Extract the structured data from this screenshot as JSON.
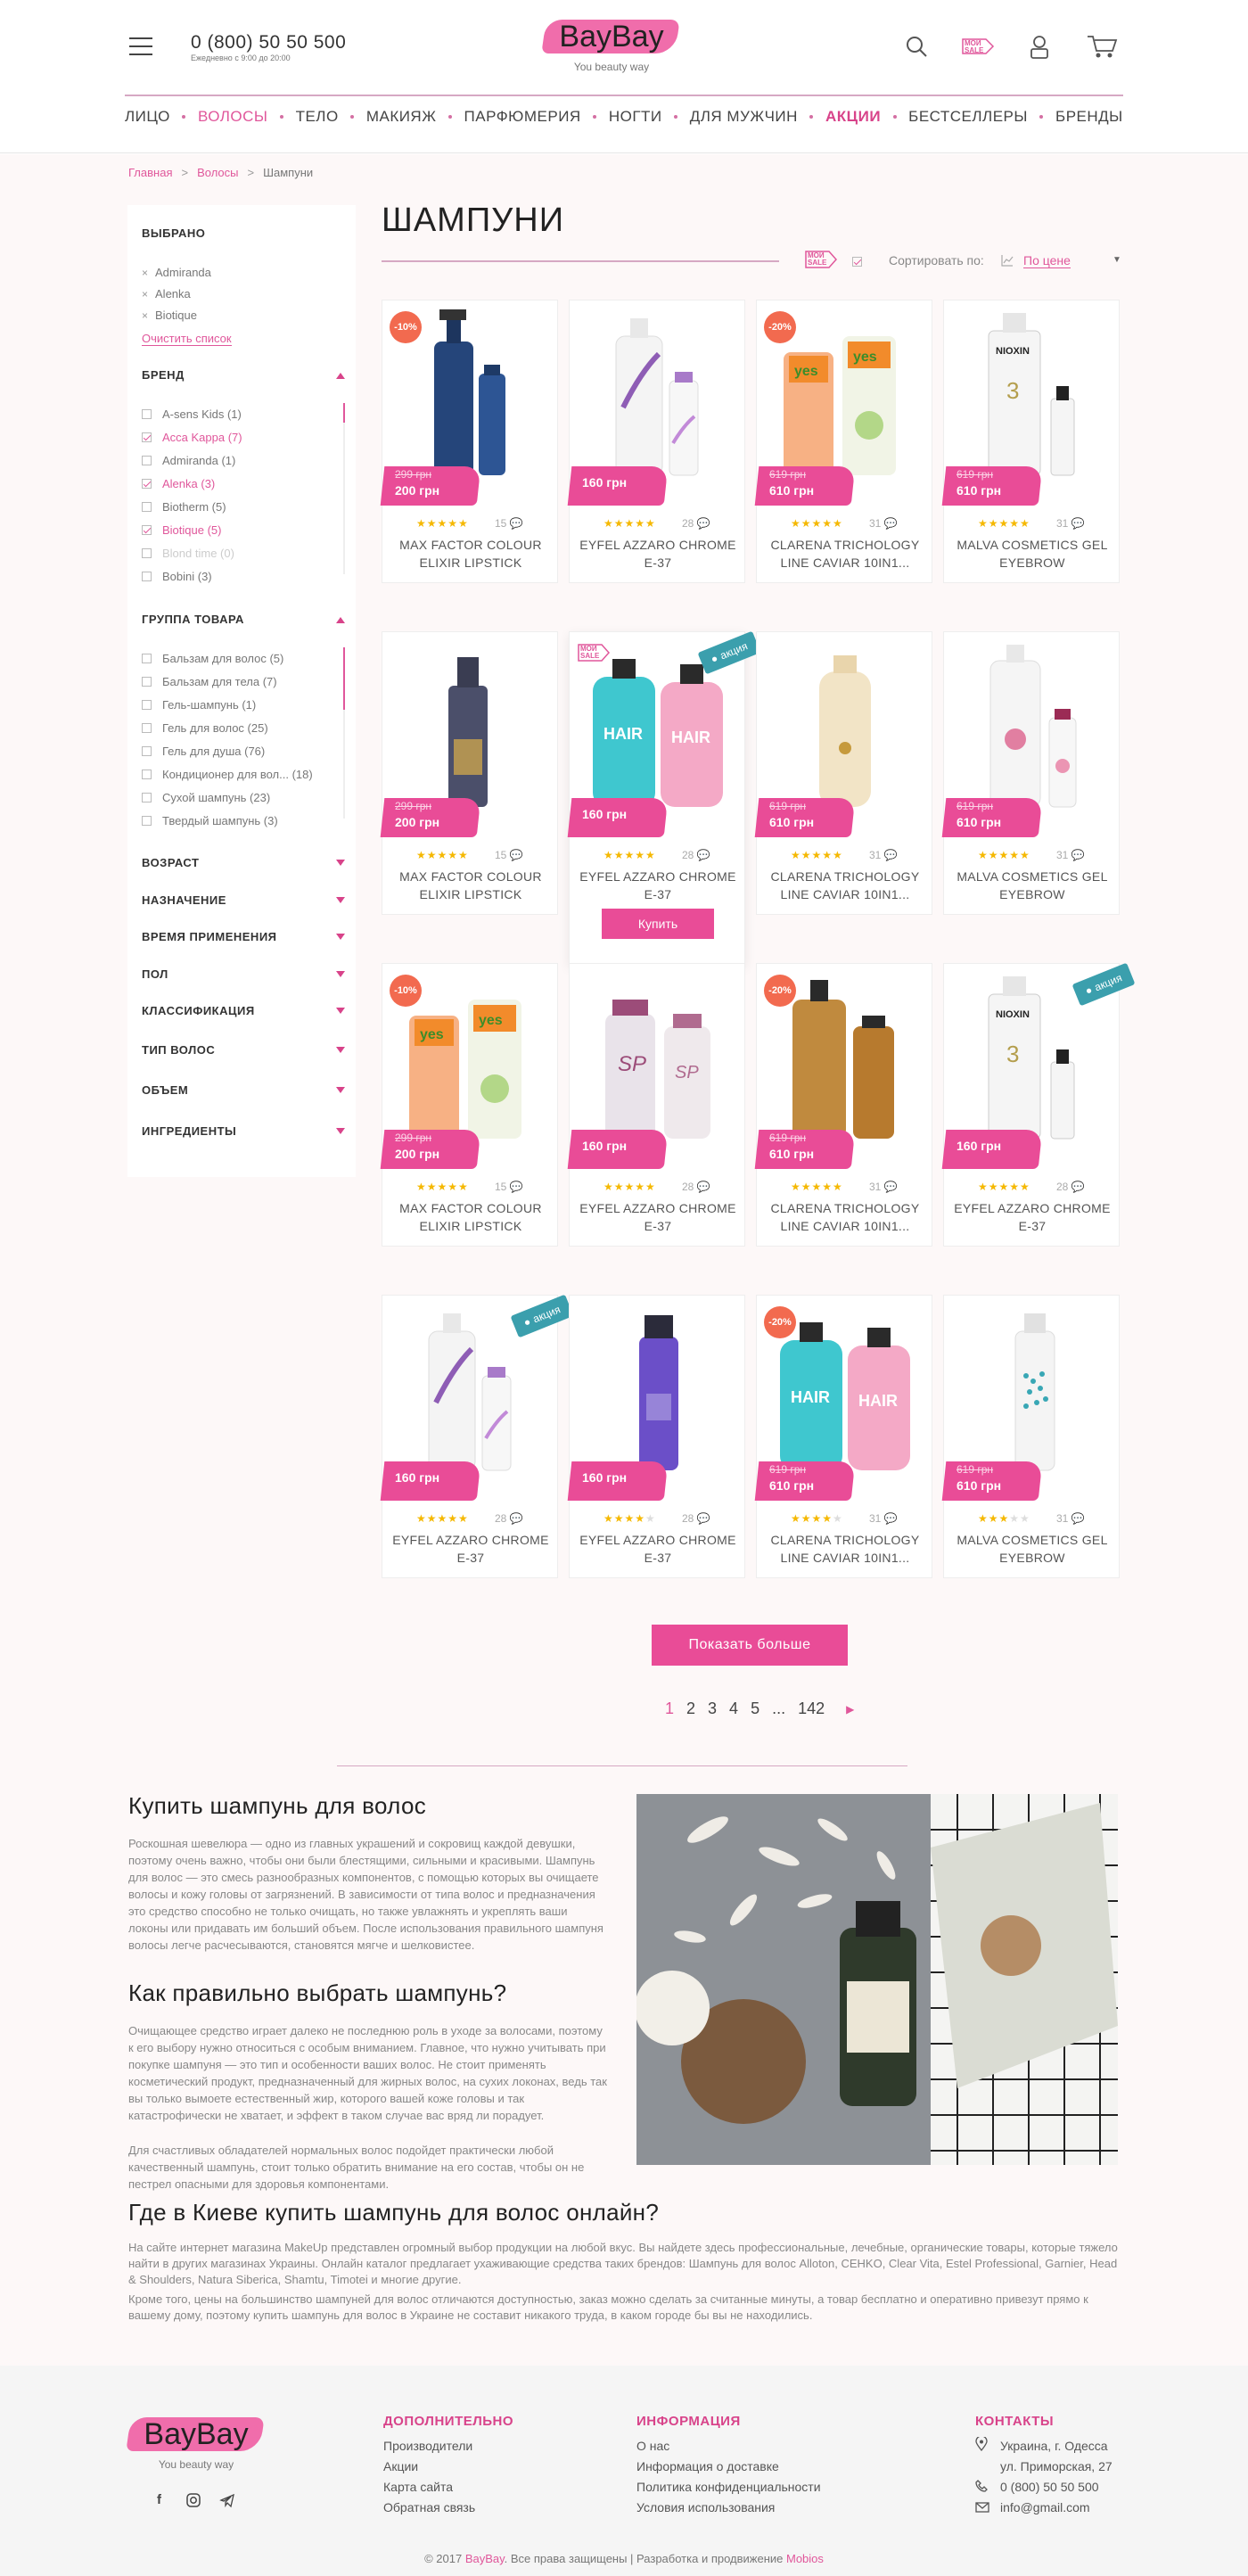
{
  "header": {
    "phone": "0 (800) 50 50 500",
    "phone_hours": "Ежедневно с 9:00 до 20:00",
    "logo": "BayBay",
    "slogan": "You beauty way",
    "my_sale": "МОЙ SALE"
  },
  "nav": [
    "ЛИЦО",
    "ВОЛОСЫ",
    "ТЕЛО",
    "МАКИЯЖ",
    "ПАРФЮМЕРИЯ",
    "НОГТИ",
    "ДЛЯ МУЖЧИН",
    "АКЦИИ",
    "БЕСТСЕЛЛЕРЫ",
    "БРЕНДЫ"
  ],
  "breadcrumbs": [
    "Главная",
    "Волосы",
    "Шампуни"
  ],
  "sidebar": {
    "selected_title": "ВЫБРАНО",
    "selected": [
      "Admiranda",
      "Alenka",
      "Biotique"
    ],
    "clear": "Очистить список",
    "brand_title": "БРЕНД",
    "brands": [
      {
        "label": "A-sens Kids (1)",
        "checked": false,
        "style": ""
      },
      {
        "label": "Acca Kappa (7)",
        "checked": true,
        "style": "pink"
      },
      {
        "label": "Admiranda (1)",
        "checked": false,
        "style": ""
      },
      {
        "label": "Alenka (3)",
        "checked": true,
        "style": "pink"
      },
      {
        "label": "Biotherm (5)",
        "checked": false,
        "style": ""
      },
      {
        "label": "Biotique (5)",
        "checked": true,
        "style": "pink"
      },
      {
        "label": "Blond time (0)",
        "checked": false,
        "style": "dim"
      },
      {
        "label": "Bobini (3)",
        "checked": false,
        "style": ""
      }
    ],
    "group_title": "ГРУППА ТОВАРА",
    "groups": [
      "Бальзам для волос (5)",
      "Бальзам для тела (7)",
      "Гель-шампунь (1)",
      "Гель для волос (25)",
      "Гель для душа (76)",
      "Кондиционер для вол... (18)",
      "Сухой шампунь (23)",
      "Твердый шампунь (3)"
    ],
    "collapsed": [
      "ВОЗРАСТ",
      "НАЗНАЧЕНИЕ",
      "ВРЕМЯ ПРИМЕНЕНИЯ",
      "ПОЛ",
      "КЛАССИФИКАЦИЯ",
      "ТИП ВОЛОС",
      "ОБЪЕМ",
      "ИНГРЕДИЕНТЫ"
    ]
  },
  "page": {
    "title": "ШАМПУНИ",
    "sort_label": "Сортировать по:",
    "sort_value": "По цене",
    "buy": "Купить",
    "sale_tag": "акция",
    "show_more": "Показать больше",
    "pages": [
      "1",
      "2",
      "3",
      "4",
      "5",
      "...",
      "142"
    ]
  },
  "products": [
    {
      "name": "MAX FACTOR COLOUR ELIXIR LIPSTICK",
      "old": "299 грн",
      "price": "200 грн",
      "discount": "-10%",
      "rating": 5,
      "reviews": "15",
      "img": "blue"
    },
    {
      "name": "EYFEL AZZARO CHROME E-37",
      "old": "",
      "price": "160 грн",
      "discount": "",
      "rating": 5,
      "reviews": "28",
      "img": "purple"
    },
    {
      "name": "CLARENA TRICHOLOGY LINE CAVIAR 10IN1...",
      "old": "619 грн",
      "price": "610 грн",
      "discount": "-20%",
      "rating": 5,
      "reviews": "31",
      "img": "orange"
    },
    {
      "name": "MALVA COSMETICS GEL EYEBROW",
      "old": "619 грн",
      "price": "610 грн",
      "discount": "",
      "rating": 5,
      "reviews": "31",
      "img": "nioxin"
    },
    {
      "name": "MAX FACTOR COLOUR ELIXIR LIPSTICK",
      "old": "299 грн",
      "price": "200 грн",
      "discount": "",
      "rating": 5,
      "reviews": "15",
      "img": "dark"
    },
    {
      "name": "EYFEL AZZARO CHROME E-37",
      "old": "",
      "price": "160 грн",
      "discount": "",
      "rating": 5,
      "reviews": "28",
      "img": "hair",
      "tag": true,
      "msale": true,
      "buy": true
    },
    {
      "name": "CLARENA TRICHOLOGY LINE CAVIAR 10IN1...",
      "old": "619 грн",
      "price": "610 грн",
      "discount": "",
      "rating": 5,
      "reviews": "31",
      "img": "cream"
    },
    {
      "name": "MALVA COSMETICS GEL EYEBROW",
      "old": "619 грн",
      "price": "610 грн",
      "discount": "",
      "rating": 5,
      "reviews": "31",
      "img": "redpink"
    },
    {
      "name": "MAX FACTOR COLOUR ELIXIR LIPSTICK",
      "old": "299 грн",
      "price": "200 грн",
      "discount": "-10%",
      "rating": 5,
      "reviews": "15",
      "img": "orange"
    },
    {
      "name": "EYFEL AZZARO CHROME E-37",
      "old": "",
      "price": "160 грн",
      "discount": "",
      "rating": 5,
      "reviews": "28",
      "img": "sp"
    },
    {
      "name": "CLARENA TRICHOLOGY LINE CAVIAR 10IN1...",
      "old": "619 грн",
      "price": "610 грн",
      "discount": "-20%",
      "rating": 5,
      "reviews": "31",
      "img": "gold"
    },
    {
      "name": "EYFEL AZZARO CHROME E-37",
      "old": "",
      "price": "160 грн",
      "discount": "",
      "rating": 5,
      "reviews": "28",
      "img": "nioxin",
      "tag": true
    },
    {
      "name": "EYFEL AZZARO CHROME E-37",
      "old": "",
      "price": "160 грн",
      "discount": "",
      "rating": 5,
      "reviews": "28",
      "img": "purple",
      "tag": true
    },
    {
      "name": "EYFEL AZZARO CHROME E-37",
      "old": "",
      "price": "160 грн",
      "discount": "",
      "rating": 4,
      "reviews": "28",
      "img": "violet"
    },
    {
      "name": "CLARENA TRICHOLOGY LINE CAVIAR 10IN1...",
      "old": "619 грн",
      "price": "610 грн",
      "discount": "-20%",
      "rating": 4,
      "reviews": "31",
      "img": "hair"
    },
    {
      "name": "MALVA COSMETICS GEL EYEBROW",
      "old": "619 грн",
      "price": "610 грн",
      "discount": "",
      "rating": 3,
      "reviews": "31",
      "img": "spray"
    }
  ],
  "seo": {
    "h1": "Купить шампунь для волос",
    "p1": "Роскошная шевелюра — одно из главных украшений и сокровищ каждой девушки, поэтому очень важно, чтобы они были блестящими, сильными и красивыми. Шампунь для волос — это смесь разнообразных компонентов, с помощью которых вы очищаете волосы и кожу головы от загрязнений. В зависимости от типа волос и предназначения это средство способно не только очищать, но также увлажнять и укреплять ваши локоны или придавать им больший объем. После использования правильного шампуня волосы легче расчесываются, становятся мягче и шелковистее.",
    "h2": "Как правильно выбрать шампунь?",
    "p2": "Очищающее средство играет далеко не последнюю роль в уходе за волосами, поэтому к его выбору нужно относиться с особым вниманием. Главное, что нужно учитывать при покупке шампуня — это тип и особенности ваших волос. Не стоит применять косметический продукт, предназначенный для жирных волос, на сухих локонах, ведь так вы только вымоете естественный жир, которого вашей коже головы и так катастрофически не хватает, и эффект в таком случае вас вряд ли порадует.",
    "p3": "Для счастливых обладателей нормальных волос подойдет практически любой качественный шампунь, стоит только обратить внимание на его состав, чтобы он не пестрел опасными для здоровья компонентами.",
    "h3": "Где в Киеве купить шампунь для волос онлайн?",
    "p4": "На сайте интернет магазина MakeUp представлен огромный выбор продукции на любой вкус. Вы найдете здесь профессиональные, лечебные, органические товары, которые тяжело найти в других магазинах Украины. Онлайн каталог предлагает ухаживающие средства таких брендов: Шампунь для волос Alloton, CEHKO, Clear Vita, Estel Professional, Garnier, Head & Shoulders, Natura Siberica, Shamtu, Timotei и многие другие.",
    "p5": "Кроме того, цены на большинство шампуней для волос отличаются доступностью, заказ можно сделать за считанные минуты, а товар бесплатно и оперативно привезут прямо к вашему дому, поэтому купить шампунь для волос в Украине не составит никакого труда, в каком городе бы вы не находились."
  },
  "footer": {
    "col1_title": "ДОПОЛНИТЕЛЬНО",
    "col1": [
      "Производители",
      "Акции",
      "Карта сайта",
      "Обратная связь"
    ],
    "col2_title": "ИНФОРМАЦИЯ",
    "col2": [
      "О нас",
      "Информация о доставке",
      "Политика конфиденциальности",
      "Условия использования"
    ],
    "col3_title": "КОНТАКТЫ",
    "address1": "Украина, г. Одесса",
    "address2": "ул. Приморская, 27",
    "phone": "0 (800) 50 50 500",
    "email": "info@gmail.com",
    "copy_a": "© 2017 ",
    "copy_brand": "BayBay",
    "copy_b": ". Все права защищены | Разработка и продвижение ",
    "copy_dev": "Mobios"
  },
  "colors": {
    "accent": "#e94c97",
    "discount": "#f26a4f",
    "tag": "#3b9fad"
  }
}
